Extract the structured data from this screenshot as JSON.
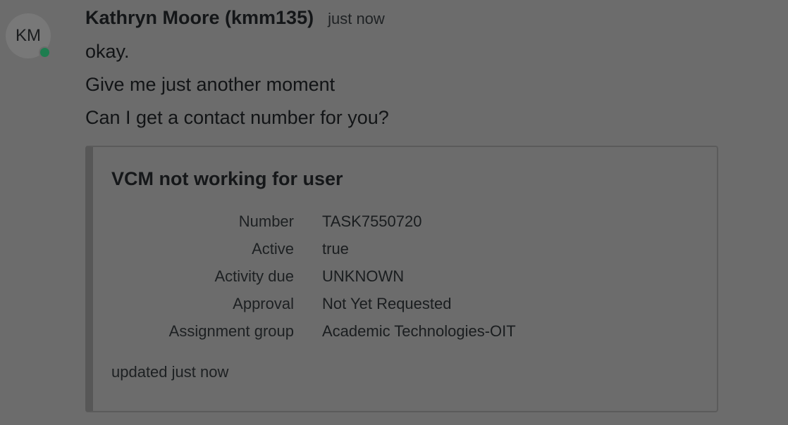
{
  "message": {
    "avatar_initials": "KM",
    "presence_status": "online",
    "sender": "Kathryn Moore (kmm135)",
    "timestamp": "just now",
    "lines": [
      "okay.",
      "Give me just another moment",
      "Can I get a contact number for you?"
    ]
  },
  "card": {
    "title": "VCM not working for user",
    "fields": [
      {
        "label": "Number",
        "value": "TASK7550720"
      },
      {
        "label": "Active",
        "value": "true"
      },
      {
        "label": "Activity due",
        "value": "UNKNOWN"
      },
      {
        "label": "Approval",
        "value": "Not Yet Requested"
      },
      {
        "label": "Assignment group",
        "value": "Academic Technologies-OIT"
      }
    ],
    "footer": "updated just now"
  },
  "colors": {
    "background": "#6c6c6c",
    "presence_online": "#1e7d4f",
    "card_accent": "#575757"
  }
}
